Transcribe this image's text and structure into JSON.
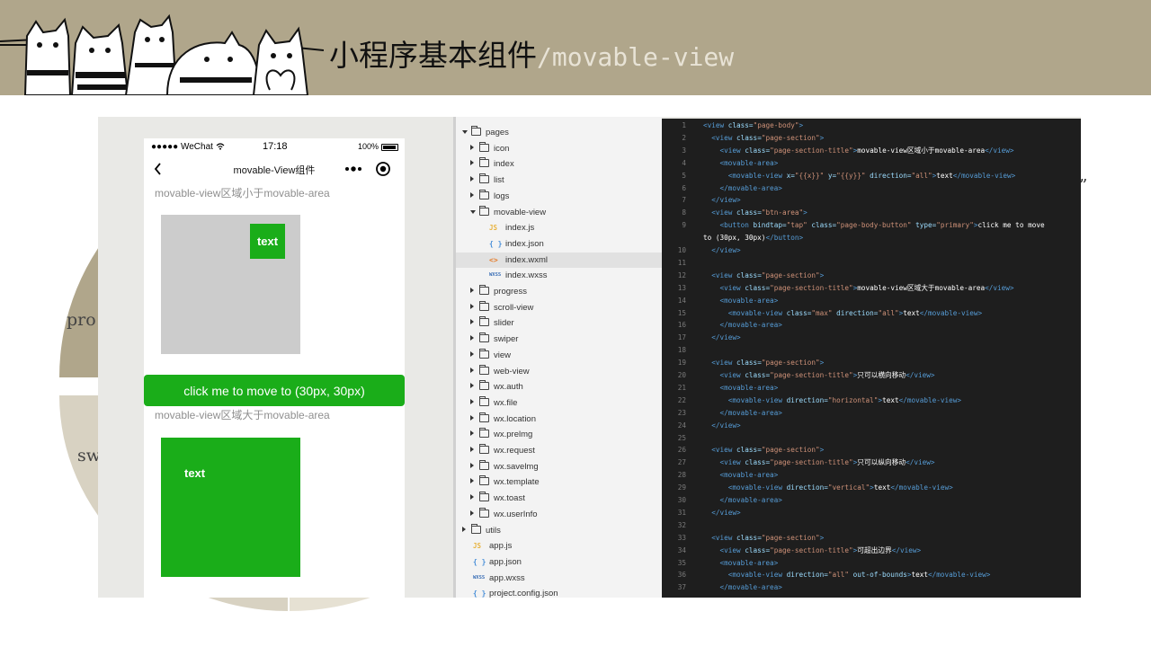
{
  "slide": {
    "title_main": "小程序基本组件",
    "title_sep": "/",
    "title_sub": "movable-view",
    "bg_labels": [
      "pro",
      "sw"
    ],
    "quote_mark": "”"
  },
  "colors": {
    "header_bg": "#b0a68b",
    "green": "#1aad19",
    "gray_area": "#cccccc",
    "editor_bg": "#1e1e1e",
    "tag": "#569cd6",
    "attr": "#9cdcfe",
    "string": "#ce9178"
  },
  "phone": {
    "status": {
      "carrier": "●●●●● WeChat ",
      "wifi_icon": "wifi-icon",
      "time": "17:18",
      "battery": "100%"
    },
    "nav": {
      "title": "movable-View组件",
      "back_icon": "back-chevron-icon",
      "more_icon": "more-dots-icon",
      "record_icon": "record-icon"
    },
    "section1_title": "movable-view区域小于movable-area",
    "view1_label": "text",
    "button_label": "click me to move to (30px, 30px)",
    "section2_title": "movable-view区域大于movable-area",
    "view2_label": "text"
  },
  "file_tree": [
    {
      "label": "pages",
      "type": "folder",
      "state": "open",
      "depth": 0
    },
    {
      "label": "icon",
      "type": "folder",
      "state": "closed",
      "depth": 1
    },
    {
      "label": "index",
      "type": "folder",
      "state": "closed",
      "depth": 1
    },
    {
      "label": "list",
      "type": "folder",
      "state": "closed",
      "depth": 1
    },
    {
      "label": "logs",
      "type": "folder",
      "state": "closed",
      "depth": 1
    },
    {
      "label": "movable-view",
      "type": "folder",
      "state": "open",
      "depth": 1
    },
    {
      "label": "index.js",
      "type": "js",
      "depth": 2
    },
    {
      "label": "index.json",
      "type": "json",
      "depth": 2
    },
    {
      "label": "index.wxml",
      "type": "wxml",
      "depth": 2,
      "selected": true
    },
    {
      "label": "index.wxss",
      "type": "wxss",
      "depth": 2
    },
    {
      "label": "progress",
      "type": "folder",
      "state": "closed",
      "depth": 1
    },
    {
      "label": "scroll-view",
      "type": "folder",
      "state": "closed",
      "depth": 1
    },
    {
      "label": "slider",
      "type": "folder",
      "state": "closed",
      "depth": 1
    },
    {
      "label": "swiper",
      "type": "folder",
      "state": "closed",
      "depth": 1
    },
    {
      "label": "view",
      "type": "folder",
      "state": "closed",
      "depth": 1
    },
    {
      "label": "web-view",
      "type": "folder",
      "state": "closed",
      "depth": 1
    },
    {
      "label": "wx.auth",
      "type": "folder",
      "state": "closed",
      "depth": 1
    },
    {
      "label": "wx.file",
      "type": "folder",
      "state": "closed",
      "depth": 1
    },
    {
      "label": "wx.location",
      "type": "folder",
      "state": "closed",
      "depth": 1
    },
    {
      "label": "wx.prelmg",
      "type": "folder",
      "state": "closed",
      "depth": 1
    },
    {
      "label": "wx.request",
      "type": "folder",
      "state": "closed",
      "depth": 1
    },
    {
      "label": "wx.savelmg",
      "type": "folder",
      "state": "closed",
      "depth": 1
    },
    {
      "label": "wx.template",
      "type": "folder",
      "state": "closed",
      "depth": 1
    },
    {
      "label": "wx.toast",
      "type": "folder",
      "state": "closed",
      "depth": 1
    },
    {
      "label": "wx.userInfo",
      "type": "folder",
      "state": "closed",
      "depth": 1
    },
    {
      "label": "utils",
      "type": "folder",
      "state": "closed",
      "depth": 0
    },
    {
      "label": "app.js",
      "type": "js",
      "depth": 0
    },
    {
      "label": "app.json",
      "type": "json",
      "depth": 0
    },
    {
      "label": "app.wxss",
      "type": "wxss",
      "depth": 0
    },
    {
      "label": "project.config.json",
      "type": "json",
      "depth": 0
    }
  ],
  "file_icon_glyphs": {
    "js": "JS",
    "json": "{ }",
    "wxml": "<>",
    "wxss": "WXSS"
  },
  "code_lines": [
    {
      "n": "1",
      "tokens": [
        [
          "tag",
          "<view "
        ],
        [
          "attr",
          "class="
        ],
        [
          "str",
          "\"page-body\""
        ],
        [
          "tag",
          ">"
        ]
      ]
    },
    {
      "n": "2",
      "tokens": [
        [
          "",
          "  "
        ],
        [
          "tag",
          "<view "
        ],
        [
          "attr",
          "class="
        ],
        [
          "str",
          "\"page-section\""
        ],
        [
          "tag",
          ">"
        ]
      ]
    },
    {
      "n": "3",
      "tokens": [
        [
          "",
          "    "
        ],
        [
          "tag",
          "<view "
        ],
        [
          "attr",
          "class="
        ],
        [
          "str",
          "\"page-section-title\""
        ],
        [
          "tag",
          ">"
        ],
        [
          "txt",
          "movable-view区域小于movable-area"
        ],
        [
          "tag",
          "</view>"
        ]
      ]
    },
    {
      "n": "4",
      "tokens": [
        [
          "",
          "    "
        ],
        [
          "tag",
          "<movable-area>"
        ]
      ]
    },
    {
      "n": "5",
      "tokens": [
        [
          "",
          "      "
        ],
        [
          "tag",
          "<movable-view "
        ],
        [
          "attr",
          "x="
        ],
        [
          "str",
          "\"{{x}}\" "
        ],
        [
          "attr",
          "y="
        ],
        [
          "str",
          "\"{{y}}\" "
        ],
        [
          "attr",
          "direction="
        ],
        [
          "str",
          "\"all\""
        ],
        [
          "tag",
          ">"
        ],
        [
          "txt",
          "text"
        ],
        [
          "tag",
          "</movable-view>"
        ]
      ]
    },
    {
      "n": "6",
      "tokens": [
        [
          "",
          "    "
        ],
        [
          "tag",
          "</movable-area>"
        ]
      ]
    },
    {
      "n": "7",
      "tokens": [
        [
          "",
          "  "
        ],
        [
          "tag",
          "</view>"
        ]
      ]
    },
    {
      "n": "8",
      "tokens": [
        [
          "",
          "  "
        ],
        [
          "tag",
          "<view "
        ],
        [
          "attr",
          "class="
        ],
        [
          "str",
          "\"btn-area\""
        ],
        [
          "tag",
          ">"
        ]
      ]
    },
    {
      "n": "9",
      "tokens": [
        [
          "",
          "    "
        ],
        [
          "tag",
          "<button "
        ],
        [
          "attr",
          "bindtap="
        ],
        [
          "str",
          "\"tap\" "
        ],
        [
          "attr",
          "class="
        ],
        [
          "str",
          "\"page-body-button\" "
        ],
        [
          "attr",
          "type="
        ],
        [
          "str",
          "\"primary\""
        ],
        [
          "tag",
          ">"
        ],
        [
          "txt",
          "click me to move"
        ]
      ]
    },
    {
      "n": "",
      "wrap": true,
      "tokens": [
        [
          "txt",
          "to (30px, 30px)"
        ],
        [
          "tag",
          "</button>"
        ]
      ]
    },
    {
      "n": "10",
      "tokens": [
        [
          "",
          "  "
        ],
        [
          "tag",
          "</view>"
        ]
      ]
    },
    {
      "n": "11",
      "tokens": []
    },
    {
      "n": "12",
      "tokens": [
        [
          "",
          "  "
        ],
        [
          "tag",
          "<view "
        ],
        [
          "attr",
          "class="
        ],
        [
          "str",
          "\"page-section\""
        ],
        [
          "tag",
          ">"
        ]
      ]
    },
    {
      "n": "13",
      "tokens": [
        [
          "",
          "    "
        ],
        [
          "tag",
          "<view "
        ],
        [
          "attr",
          "class="
        ],
        [
          "str",
          "\"page-section-title\""
        ],
        [
          "tag",
          ">"
        ],
        [
          "txt",
          "movable-view区域大于movable-area"
        ],
        [
          "tag",
          "</view>"
        ]
      ]
    },
    {
      "n": "14",
      "tokens": [
        [
          "",
          "    "
        ],
        [
          "tag",
          "<movable-area>"
        ]
      ]
    },
    {
      "n": "15",
      "tokens": [
        [
          "",
          "      "
        ],
        [
          "tag",
          "<movable-view "
        ],
        [
          "attr",
          "class="
        ],
        [
          "str",
          "\"max\" "
        ],
        [
          "attr",
          "direction="
        ],
        [
          "str",
          "\"all\""
        ],
        [
          "tag",
          ">"
        ],
        [
          "txt",
          "text"
        ],
        [
          "tag",
          "</movable-view>"
        ]
      ]
    },
    {
      "n": "16",
      "tokens": [
        [
          "",
          "    "
        ],
        [
          "tag",
          "</movable-area>"
        ]
      ]
    },
    {
      "n": "17",
      "tokens": [
        [
          "",
          "  "
        ],
        [
          "tag",
          "</view>"
        ]
      ]
    },
    {
      "n": "18",
      "tokens": []
    },
    {
      "n": "19",
      "tokens": [
        [
          "",
          "  "
        ],
        [
          "tag",
          "<view "
        ],
        [
          "attr",
          "class="
        ],
        [
          "str",
          "\"page-section\""
        ],
        [
          "tag",
          ">"
        ]
      ]
    },
    {
      "n": "20",
      "tokens": [
        [
          "",
          "    "
        ],
        [
          "tag",
          "<view "
        ],
        [
          "attr",
          "class="
        ],
        [
          "str",
          "\"page-section-title\""
        ],
        [
          "tag",
          ">"
        ],
        [
          "txt",
          "只可以横向移动"
        ],
        [
          "tag",
          "</view>"
        ]
      ]
    },
    {
      "n": "21",
      "tokens": [
        [
          "",
          "    "
        ],
        [
          "tag",
          "<movable-area>"
        ]
      ]
    },
    {
      "n": "22",
      "tokens": [
        [
          "",
          "      "
        ],
        [
          "tag",
          "<movable-view "
        ],
        [
          "attr",
          "direction="
        ],
        [
          "str",
          "\"horizontal\""
        ],
        [
          "tag",
          ">"
        ],
        [
          "txt",
          "text"
        ],
        [
          "tag",
          "</movable-view>"
        ]
      ]
    },
    {
      "n": "23",
      "tokens": [
        [
          "",
          "    "
        ],
        [
          "tag",
          "</movable-area>"
        ]
      ]
    },
    {
      "n": "24",
      "tokens": [
        [
          "",
          "  "
        ],
        [
          "tag",
          "</view>"
        ]
      ]
    },
    {
      "n": "25",
      "tokens": []
    },
    {
      "n": "26",
      "tokens": [
        [
          "",
          "  "
        ],
        [
          "tag",
          "<view "
        ],
        [
          "attr",
          "class="
        ],
        [
          "str",
          "\"page-section\""
        ],
        [
          "tag",
          ">"
        ]
      ]
    },
    {
      "n": "27",
      "tokens": [
        [
          "",
          "    "
        ],
        [
          "tag",
          "<view "
        ],
        [
          "attr",
          "class="
        ],
        [
          "str",
          "\"page-section-title\""
        ],
        [
          "tag",
          ">"
        ],
        [
          "txt",
          "只可以纵向移动"
        ],
        [
          "tag",
          "</view>"
        ]
      ]
    },
    {
      "n": "28",
      "tokens": [
        [
          "",
          "    "
        ],
        [
          "tag",
          "<movable-area>"
        ]
      ]
    },
    {
      "n": "29",
      "tokens": [
        [
          "",
          "      "
        ],
        [
          "tag",
          "<movable-view "
        ],
        [
          "attr",
          "direction="
        ],
        [
          "str",
          "\"vertical\""
        ],
        [
          "tag",
          ">"
        ],
        [
          "txt",
          "text"
        ],
        [
          "tag",
          "</movable-view>"
        ]
      ]
    },
    {
      "n": "30",
      "tokens": [
        [
          "",
          "    "
        ],
        [
          "tag",
          "</movable-area>"
        ]
      ]
    },
    {
      "n": "31",
      "tokens": [
        [
          "",
          "  "
        ],
        [
          "tag",
          "</view>"
        ]
      ]
    },
    {
      "n": "32",
      "tokens": []
    },
    {
      "n": "33",
      "tokens": [
        [
          "",
          "  "
        ],
        [
          "tag",
          "<view "
        ],
        [
          "attr",
          "class="
        ],
        [
          "str",
          "\"page-section\""
        ],
        [
          "tag",
          ">"
        ]
      ]
    },
    {
      "n": "34",
      "tokens": [
        [
          "",
          "    "
        ],
        [
          "tag",
          "<view "
        ],
        [
          "attr",
          "class="
        ],
        [
          "str",
          "\"page-section-title\""
        ],
        [
          "tag",
          ">"
        ],
        [
          "txt",
          "可超出边界"
        ],
        [
          "tag",
          "</view>"
        ]
      ]
    },
    {
      "n": "35",
      "tokens": [
        [
          "",
          "    "
        ],
        [
          "tag",
          "<movable-area>"
        ]
      ]
    },
    {
      "n": "36",
      "tokens": [
        [
          "",
          "      "
        ],
        [
          "tag",
          "<movable-view "
        ],
        [
          "attr",
          "direction="
        ],
        [
          "str",
          "\"all\" "
        ],
        [
          "attr",
          "out-of-bounds"
        ],
        [
          "tag",
          ">"
        ],
        [
          "txt",
          "text"
        ],
        [
          "tag",
          "</movable-view>"
        ]
      ]
    },
    {
      "n": "37",
      "tokens": [
        [
          "",
          "    "
        ],
        [
          "tag",
          "</movable-area>"
        ]
      ]
    }
  ]
}
